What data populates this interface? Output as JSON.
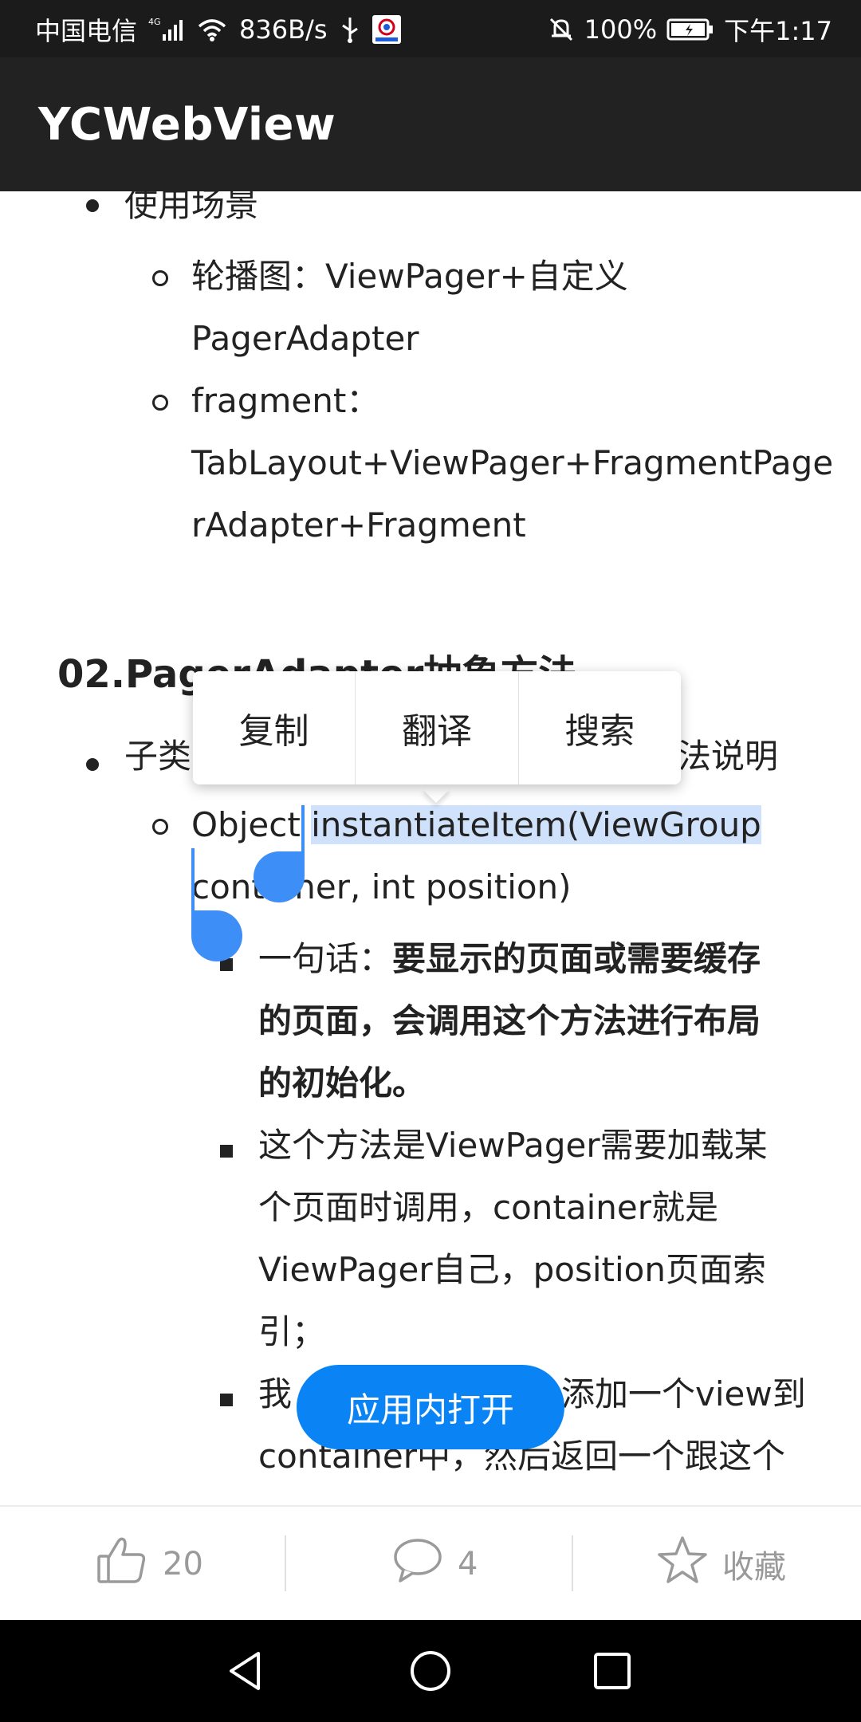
{
  "status_bar": {
    "carrier": "中国电信",
    "network": "4G",
    "speed": "836B/s",
    "battery": "100%",
    "time": "下午1:17"
  },
  "app_bar": {
    "title": "YCWebView"
  },
  "article": {
    "usage_heading_bullet": "使用场景",
    "item_carousel_line1": "轮播图：ViewPager+自定义",
    "item_carousel_line2": "PagerAdapter",
    "item_fragment_line1": "fragment：",
    "item_fragment_line2": "TabLayout+ViewPager+FragmentPage",
    "item_fragment_line3": "rAdapter+Fragment",
    "section_heading": "02.PagerAdapter抽象方法",
    "subclass_bullet_start": "子类",
    "subclass_bullet_end": "法说明",
    "method_prefix": "Object ",
    "method_selected": "instantiateItem(ViewGroup ",
    "method_line2": "container, int position)",
    "summary_label": "一句话：",
    "summary_bold_line1": "要显示的页面或需要缓存",
    "summary_bold_line2": "的页面，会调用这个方法进行布局",
    "summary_bold_line3": "的初始化。",
    "detail1_line1": "这个方法是ViewPager需要加载某",
    "detail1_line2": "个页面时调用，container就是",
    "detail1_line3": "ViewPager自己，position页面索",
    "detail1_line4": "引；",
    "detail2_start": "我",
    "detail2_end": "添加一个view到",
    "detail2_line2": "container中，然后返回一个跟这个"
  },
  "context_menu": {
    "copy": "复制",
    "translate": "翻译",
    "search": "搜索"
  },
  "float_button": {
    "label": "应用内打开"
  },
  "action_bar": {
    "like_count": "20",
    "comment_count": "4",
    "favorite_label": "收藏"
  },
  "colors": {
    "accent": "#0a84f5",
    "selection": "#cfe1fb",
    "handle": "#3e8ef7",
    "app_bar": "#222222"
  },
  "icons": [
    "signal-icon",
    "wifi-icon",
    "usb-icon",
    "app-notification-icon",
    "mute-icon",
    "battery-icon",
    "thumbs-up-icon",
    "comment-icon",
    "star-icon",
    "back-icon",
    "home-icon",
    "recents-icon"
  ]
}
